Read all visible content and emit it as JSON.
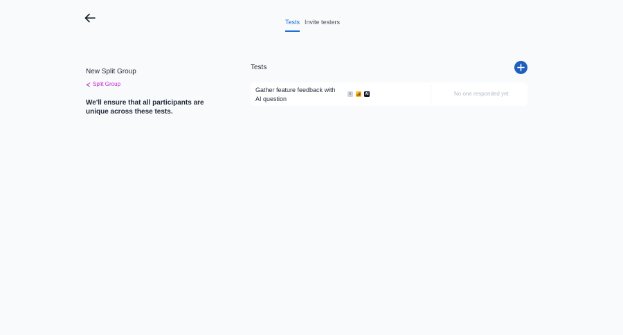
{
  "tabs": [
    {
      "label": "Tests",
      "active": true
    },
    {
      "label": "Invite testers",
      "active": false
    }
  ],
  "group": {
    "title": "New Split Group",
    "type_label": "Split Group",
    "type_icon": "split-icon",
    "description": "We'll ensure that all participants are unique across these tests."
  },
  "tests_section": {
    "label": "Tests",
    "add_icon": "plus-icon"
  },
  "tests": [
    {
      "name": "Gather feature feedback with AI question",
      "badges": [
        {
          "icon": "info-icon",
          "text": "i"
        },
        {
          "icon": "chart-icon",
          "text": ""
        },
        {
          "icon": "ai-icon",
          "text": "AI"
        }
      ],
      "status": "No one responded yet"
    }
  ],
  "colors": {
    "accent": "#1d6fd6",
    "add_button": "#1f5fbf",
    "split_group": "#c026d3",
    "background": "#f9fafb"
  }
}
